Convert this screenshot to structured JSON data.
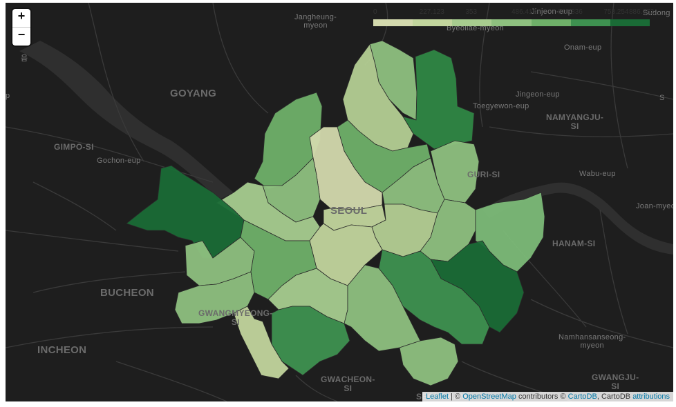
{
  "map": {
    "zoom": {
      "in_label": "+",
      "out_label": "−"
    },
    "legend": {
      "ticks": [
        "0",
        "227.123",
        "353",
        "486.418",
        "619.836",
        "753.254",
        "886.672"
      ],
      "colors": [
        "#f7fcf5",
        "#e5f5e0",
        "#c7e9c0",
        "#a1d99b",
        "#74c476",
        "#41ab5d",
        "#238b45",
        "#006d2c",
        "#00441b"
      ],
      "swatches": [
        "#d3d9ad",
        "#c2d59d",
        "#a7cc8f",
        "#8ec07f",
        "#6fb069",
        "#3e9150",
        "#1a6b36"
      ]
    },
    "places": [
      {
        "id": "goyang",
        "text": "GOYANG",
        "cls": "big"
      },
      {
        "id": "gimpo",
        "text": "GIMPO-SI",
        "cls": ""
      },
      {
        "id": "gochon",
        "text": "Gochon-eup",
        "cls": "small"
      },
      {
        "id": "jangheung",
        "text": "Jangheung-\nmyeon",
        "cls": "small"
      },
      {
        "id": "byeollae",
        "text": "Byeollae-myeon",
        "cls": "small"
      },
      {
        "id": "jinjeon",
        "text": "Jinjeon-eup",
        "cls": "small"
      },
      {
        "id": "sudong",
        "text": "Sudong",
        "cls": "small"
      },
      {
        "id": "onam",
        "text": "Onam-eup",
        "cls": "small"
      },
      {
        "id": "jingeon",
        "text": "Jingeon-eup",
        "cls": "small"
      },
      {
        "id": "toegyewon",
        "text": "Toegyewon-eup",
        "cls": "small"
      },
      {
        "id": "namyangju",
        "text": "NAMYANGJU-\nSI",
        "cls": ""
      },
      {
        "id": "guri",
        "text": "GURI-SI",
        "cls": ""
      },
      {
        "id": "wabu",
        "text": "Wabu-eup",
        "cls": "small"
      },
      {
        "id": "joan",
        "text": "Joan-myeo",
        "cls": "small"
      },
      {
        "id": "hanam",
        "text": "HANAM-SI",
        "cls": ""
      },
      {
        "id": "seoul",
        "text": "SEOUL",
        "cls": "big"
      },
      {
        "id": "bucheon",
        "text": "BUCHEON",
        "cls": "big"
      },
      {
        "id": "gwangmyeong",
        "text": "GWANGMYEONG-\nSI",
        "cls": ""
      },
      {
        "id": "incheon",
        "text": "INCHEON",
        "cls": "big"
      },
      {
        "id": "gwacheon",
        "text": "GWACHEON-\nSI",
        "cls": ""
      },
      {
        "id": "seongnam",
        "text": "SEONGNAM-",
        "cls": ""
      },
      {
        "id": "namhansanseong",
        "text": "Namhansanseong-\nmyeon",
        "cls": "small"
      },
      {
        "id": "gwangju",
        "text": "GWANGJU-\nSI",
        "cls": ""
      },
      {
        "id": "topleft",
        "text": "읍",
        "cls": "small"
      },
      {
        "id": "p-left",
        "text": "p",
        "cls": "small"
      },
      {
        "id": "s-right",
        "text": "S",
        "cls": "small"
      }
    ],
    "districts": [
      {
        "id": "dobong",
        "color": "#8ec07f"
      },
      {
        "id": "nowon",
        "color": "#2f8745"
      },
      {
        "id": "gangbuk",
        "color": "#b4cf93"
      },
      {
        "id": "eunpyeong",
        "color": "#6fb069"
      },
      {
        "id": "seongbuk",
        "color": "#6fb069"
      },
      {
        "id": "jongno",
        "color": "#d3d9ad"
      },
      {
        "id": "jungnang",
        "color": "#8ec07f"
      },
      {
        "id": "dongdaemun",
        "color": "#8ec07f"
      },
      {
        "id": "seodaemun",
        "color": "#8ec07f"
      },
      {
        "id": "jung",
        "color": "#c2d59d"
      },
      {
        "id": "mapo",
        "color": "#a7cc8f"
      },
      {
        "id": "seongdong",
        "color": "#b4cf93"
      },
      {
        "id": "gwangjin",
        "color": "#8ec07f"
      },
      {
        "id": "gangdong",
        "color": "#7cba78"
      },
      {
        "id": "gangseo",
        "color": "#1a6b36"
      },
      {
        "id": "yangcheon",
        "color": "#8ec07f"
      },
      {
        "id": "yongsan",
        "color": "#c2d59d"
      },
      {
        "id": "guro",
        "color": "#8ec07f"
      },
      {
        "id": "yeongdeungpo",
        "color": "#6fb069"
      },
      {
        "id": "dongjak",
        "color": "#a7cc8f"
      },
      {
        "id": "songpa",
        "color": "#1a6b36"
      },
      {
        "id": "gangnam",
        "color": "#3e9150"
      },
      {
        "id": "seocho",
        "color": "#8ec07f"
      },
      {
        "id": "gwanak",
        "color": "#3e9150"
      },
      {
        "id": "geumcheon",
        "color": "#c2d59d"
      },
      {
        "id": "seocho-south",
        "color": "#8ec07f"
      }
    ],
    "attribution": {
      "leaflet": "Leaflet",
      "sep": " | © ",
      "osm": "OpenStreetMap",
      "contrib": " contributors © ",
      "cartodb": "CartoDB",
      "tail": ", CartoDB ",
      "attributions": "attributions"
    }
  }
}
